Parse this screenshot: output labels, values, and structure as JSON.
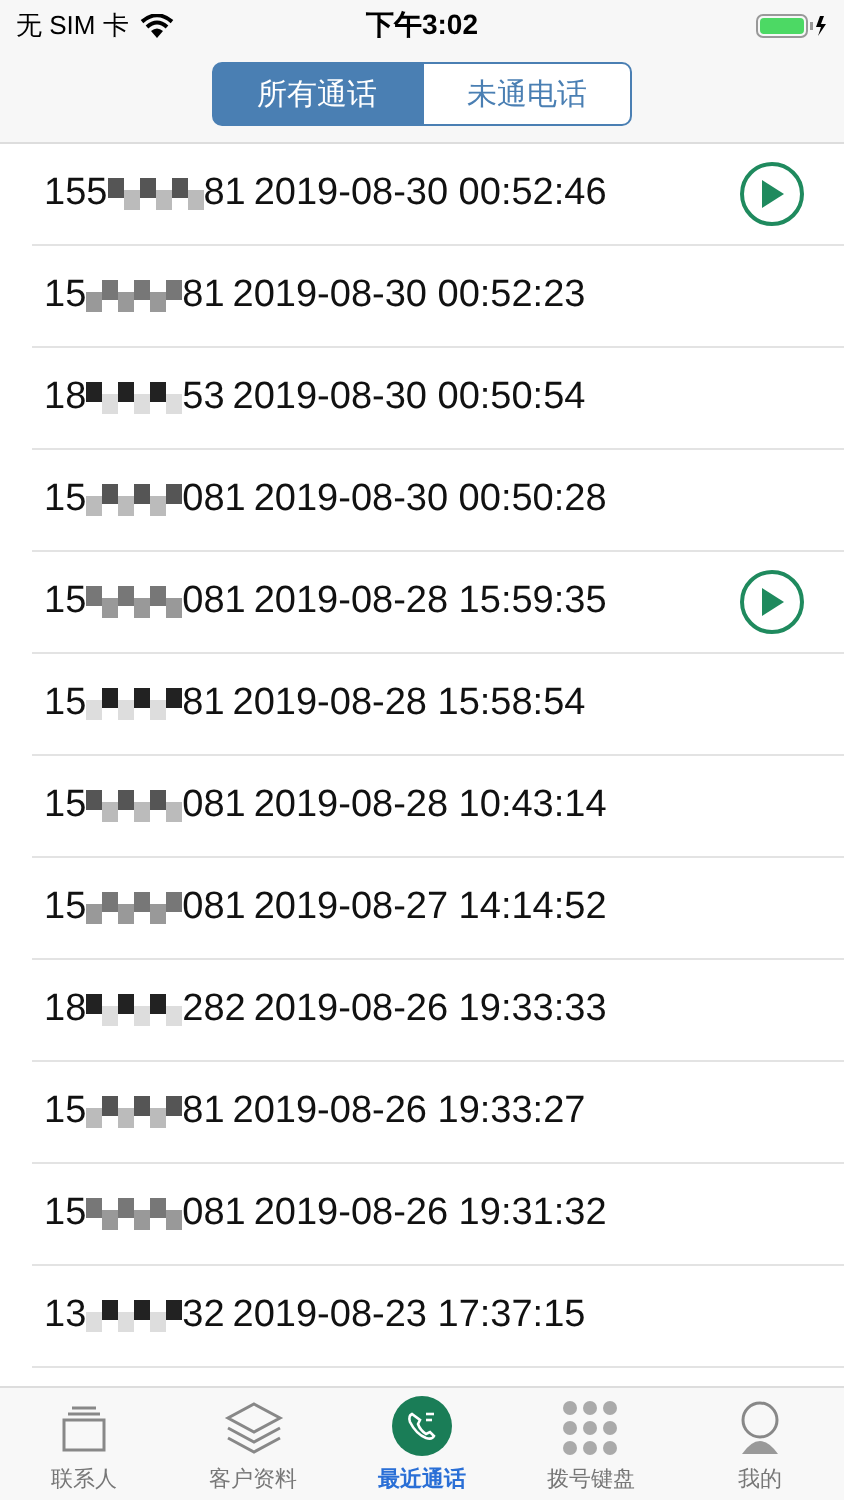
{
  "status_bar": {
    "carrier": "无 SIM 卡",
    "time": "下午3:02"
  },
  "segments": [
    {
      "label": "所有通话",
      "selected": true
    },
    {
      "label": "未通电话",
      "selected": false
    }
  ],
  "calls": [
    {
      "number_start": "155",
      "number_end": "81",
      "datetime": "2019-08-30 00:52:46",
      "has_recording": true
    },
    {
      "number_start": "15",
      "number_end": "81",
      "datetime": "2019-08-30 00:52:23",
      "has_recording": false
    },
    {
      "number_start": "18",
      "number_end": "53",
      "datetime": "2019-08-30 00:50:54",
      "has_recording": false
    },
    {
      "number_start": "15",
      "number_end": "081",
      "datetime": "2019-08-30 00:50:28",
      "has_recording": false
    },
    {
      "number_start": "15",
      "number_end": "081",
      "datetime": "2019-08-28 15:59:35",
      "has_recording": true
    },
    {
      "number_start": "15",
      "number_end": "81",
      "datetime": "2019-08-28 15:58:54",
      "has_recording": false
    },
    {
      "number_start": "15",
      "number_end": "081",
      "datetime": "2019-08-28 10:43:14",
      "has_recording": false
    },
    {
      "number_start": "15",
      "number_end": "081",
      "datetime": "2019-08-27 14:14:52",
      "has_recording": false
    },
    {
      "number_start": "18",
      "number_end": "282",
      "datetime": "2019-08-26 19:33:33",
      "has_recording": false
    },
    {
      "number_start": "15",
      "number_end": "81",
      "datetime": "2019-08-26 19:33:27",
      "has_recording": false
    },
    {
      "number_start": "15",
      "number_end": "081",
      "datetime": "2019-08-26 19:31:32",
      "has_recording": false
    },
    {
      "number_start": "13",
      "number_end": "32",
      "datetime": "2019-08-23 17:37:15",
      "has_recording": false
    }
  ],
  "tab_bar": [
    {
      "label": "联系人",
      "kind": "contacts",
      "selected": false
    },
    {
      "label": "客户资料",
      "kind": "layers",
      "selected": false
    },
    {
      "label": "最近通话",
      "kind": "recent",
      "selected": true
    },
    {
      "label": "拨号键盘",
      "kind": "keypad",
      "selected": false
    },
    {
      "label": "我的",
      "kind": "profile",
      "selected": false
    }
  ]
}
